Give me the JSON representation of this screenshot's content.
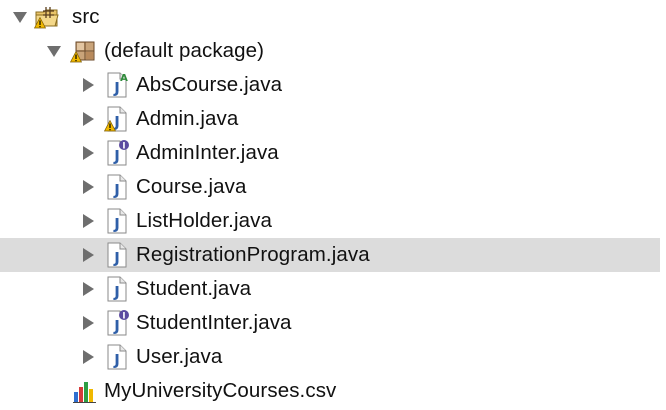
{
  "tree": {
    "src_folder": {
      "label": "src",
      "expanded": true,
      "icon": "source-folder-icon",
      "warning": true
    },
    "package": {
      "label": "(default package)",
      "expanded": true,
      "icon": "package-icon",
      "warning": true
    },
    "files": [
      {
        "label": "AbsCourse.java",
        "icon": "java-abstract-class-icon",
        "badge": "A"
      },
      {
        "label": "Admin.java",
        "icon": "java-file-icon",
        "warning": true
      },
      {
        "label": "AdminInter.java",
        "icon": "java-interface-icon",
        "badge": "I"
      },
      {
        "label": "Course.java",
        "icon": "java-file-icon"
      },
      {
        "label": "ListHolder.java",
        "icon": "java-file-icon"
      },
      {
        "label": "RegistrationProgram.java",
        "icon": "java-file-icon",
        "selected": true
      },
      {
        "label": "Student.java",
        "icon": "java-file-icon"
      },
      {
        "label": "StudentInter.java",
        "icon": "java-interface-icon",
        "badge": "I"
      },
      {
        "label": "User.java",
        "icon": "java-file-icon"
      }
    ],
    "csv_file": {
      "label": "MyUniversityCourses.csv",
      "icon": "csv-chart-icon"
    }
  },
  "colors": {
    "selection": "#dcdcdc",
    "java_j": "#2f5fa8",
    "interface_badge": "#5b4aa0",
    "abstract_badge": "#2e8b3a",
    "warning": "#f0b800"
  }
}
